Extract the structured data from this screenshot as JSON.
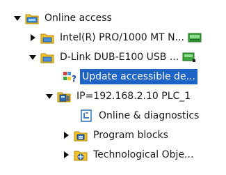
{
  "tree": {
    "root": {
      "label": "Online access",
      "icon": "online-access-folder-icon",
      "expanded": true
    },
    "adapter_intel": {
      "label": "Intel(R) PRO/1000 MT N...",
      "icon": "network-adapter-icon",
      "status_icon": "adapter-connected-icon",
      "expanded": false
    },
    "adapter_dlink": {
      "label": "D-Link DUB-E100 USB ...",
      "icon": "network-adapter-icon",
      "status_icon": "adapter-connected-icon",
      "expanded": true
    },
    "update_nodes": {
      "label": "Update accessible de...",
      "icon": "update-devices-icon",
      "selected": true
    },
    "plc": {
      "label": "IP=192.168.2.10 PLC_1",
      "icon": "plc-device-icon",
      "expanded": true
    },
    "diagnostics": {
      "label": "Online & diagnostics",
      "icon": "diagnostics-icon"
    },
    "program_blocks": {
      "label": "Program blocks",
      "icon": "program-blocks-folder-icon",
      "expanded": false
    },
    "technological": {
      "label": "Technological Obje...",
      "icon": "technology-objects-folder-icon",
      "expanded": false
    }
  },
  "colors": {
    "selection": "#1e63c6",
    "folder": "#f4c430",
    "ok_green": "#3aa53a"
  }
}
